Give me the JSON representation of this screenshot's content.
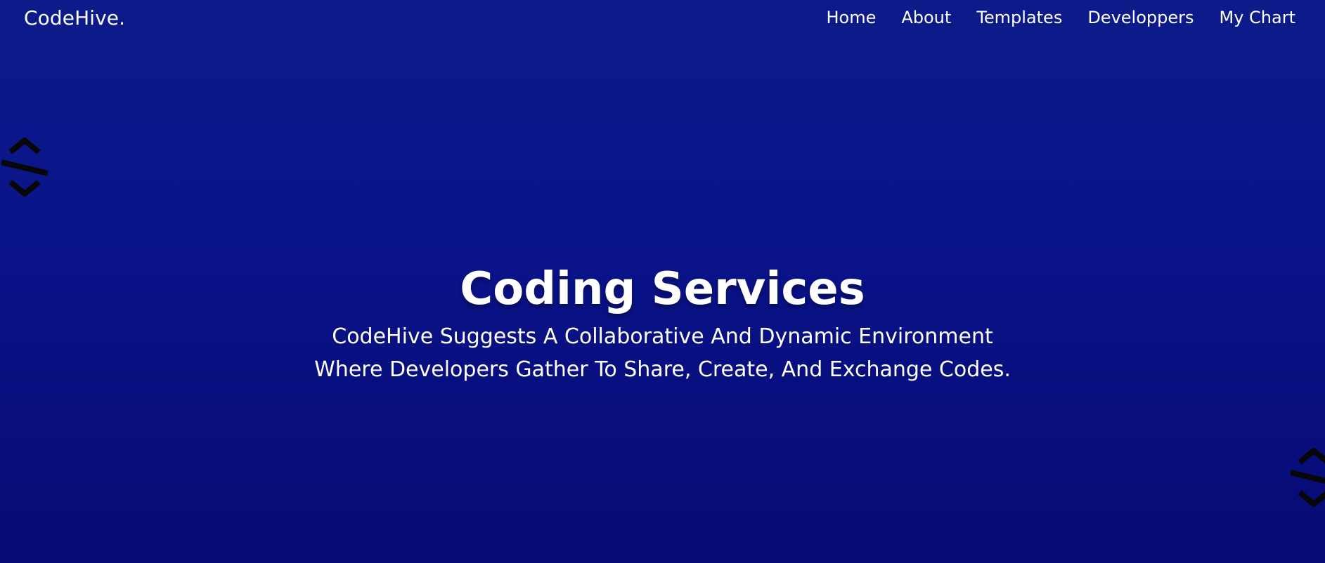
{
  "brand": "CodeHive.",
  "nav": {
    "items": [
      {
        "label": "Home"
      },
      {
        "label": "About"
      },
      {
        "label": "Templates"
      },
      {
        "label": "Developpers"
      },
      {
        "label": "My Chart"
      }
    ]
  },
  "hero": {
    "title": "Coding Services",
    "line1": "CodeHive Suggests A Collaborative And Dynamic Environment",
    "line2": "Where Developers Gather To Share, Create, And Exchange Codes."
  },
  "decorations": {
    "left_icon": "code-symbol-icon",
    "right_icon": "code-symbol-icon"
  },
  "colors": {
    "background_top": "#0d1b8a",
    "background_bottom": "#060a74",
    "text": "#ffffff"
  }
}
